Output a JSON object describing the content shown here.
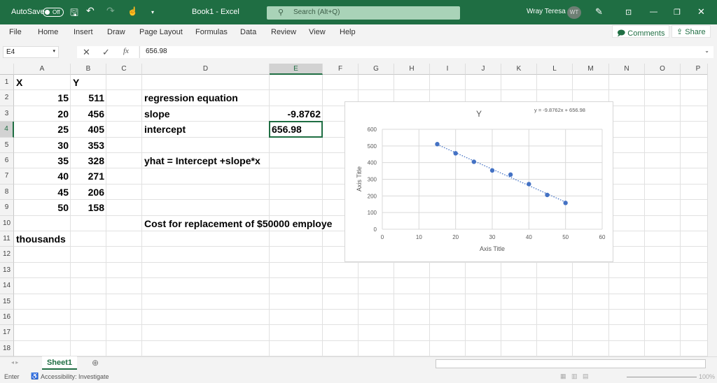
{
  "titlebar": {
    "autosave_label": "AutoSave",
    "autosave_state": "Off",
    "title": "Book1 - Excel",
    "search_placeholder": "Search (Alt+Q)",
    "user_name": "Wray Teresa",
    "user_initials": "WT",
    "bg": "#1f6e43"
  },
  "menu": {
    "items": [
      "File",
      "Home",
      "Insert",
      "Draw",
      "Page Layout",
      "Formulas",
      "Data",
      "Review",
      "View",
      "Help"
    ],
    "comments": "Comments",
    "share": "Share"
  },
  "formula_bar": {
    "name_box": "E4",
    "value": "656.98"
  },
  "columns": [
    "A",
    "B",
    "C",
    "D",
    "E",
    "F",
    "G",
    "H",
    "I",
    "J",
    "K",
    "L",
    "M",
    "N",
    "O",
    "P"
  ],
  "selected_column": "E",
  "selected_row": "4",
  "rows": [
    "1",
    "2",
    "3",
    "4",
    "5",
    "6",
    "7",
    "8",
    "9",
    "10",
    "11",
    "12",
    "13",
    "14",
    "15",
    "16",
    "17",
    "18"
  ],
  "cells": [
    {
      "ref": "A1",
      "value": "X",
      "align": "left"
    },
    {
      "ref": "B1",
      "value": "Y",
      "align": "left"
    },
    {
      "ref": "A2",
      "value": "15",
      "align": "right"
    },
    {
      "ref": "B2",
      "value": "511",
      "align": "right"
    },
    {
      "ref": "A3",
      "value": "20",
      "align": "right"
    },
    {
      "ref": "B3",
      "value": "456",
      "align": "right"
    },
    {
      "ref": "A4",
      "value": "25",
      "align": "right"
    },
    {
      "ref": "B4",
      "value": "405",
      "align": "right"
    },
    {
      "ref": "A5",
      "value": "30",
      "align": "right"
    },
    {
      "ref": "B5",
      "value": "353",
      "align": "right"
    },
    {
      "ref": "A6",
      "value": "35",
      "align": "right"
    },
    {
      "ref": "B6",
      "value": "328",
      "align": "right"
    },
    {
      "ref": "A7",
      "value": "40",
      "align": "right"
    },
    {
      "ref": "B7",
      "value": "271",
      "align": "right"
    },
    {
      "ref": "A8",
      "value": "45",
      "align": "right"
    },
    {
      "ref": "B8",
      "value": "206",
      "align": "right"
    },
    {
      "ref": "A9",
      "value": "50",
      "align": "right"
    },
    {
      "ref": "B9",
      "value": "158",
      "align": "right"
    },
    {
      "ref": "D2",
      "value": "regression equation",
      "align": "left"
    },
    {
      "ref": "D3",
      "value": "slope",
      "align": "left"
    },
    {
      "ref": "E3",
      "value": "-9.8762",
      "align": "right"
    },
    {
      "ref": "D4",
      "value": "intercept",
      "align": "left"
    },
    {
      "ref": "E4",
      "value": "656.98",
      "align": "left"
    },
    {
      "ref": "D6",
      "value": "yhat = Intercept +slope*x",
      "align": "left"
    },
    {
      "ref": "D10",
      "value": "Cost for replacement of $50000 employe",
      "align": "left"
    },
    {
      "ref": "A11",
      "value": "thousands",
      "align": "left"
    }
  ],
  "sheet_tabs": [
    "Sheet1"
  ],
  "status": {
    "mode": "Enter",
    "accessibility": "Accessibility: Investigate",
    "zoom": "100%"
  },
  "chart_data": {
    "type": "scatter",
    "title": "Y",
    "xlabel": "Axis Title",
    "ylabel": "Axis Title",
    "x": [
      15,
      20,
      25,
      30,
      35,
      40,
      45,
      50
    ],
    "y": [
      511,
      456,
      405,
      353,
      328,
      271,
      206,
      158
    ],
    "xlim": [
      0,
      60
    ],
    "ylim": [
      0,
      600
    ],
    "xticks": [
      0,
      10,
      20,
      30,
      40,
      50,
      60
    ],
    "yticks": [
      0,
      100,
      200,
      300,
      400,
      500,
      600
    ],
    "grid": true,
    "trendline": {
      "type": "linear",
      "slope": -9.8762,
      "intercept": 656.98,
      "label": "y = -9.8762x + 656.98"
    },
    "color": "#4472c4"
  }
}
